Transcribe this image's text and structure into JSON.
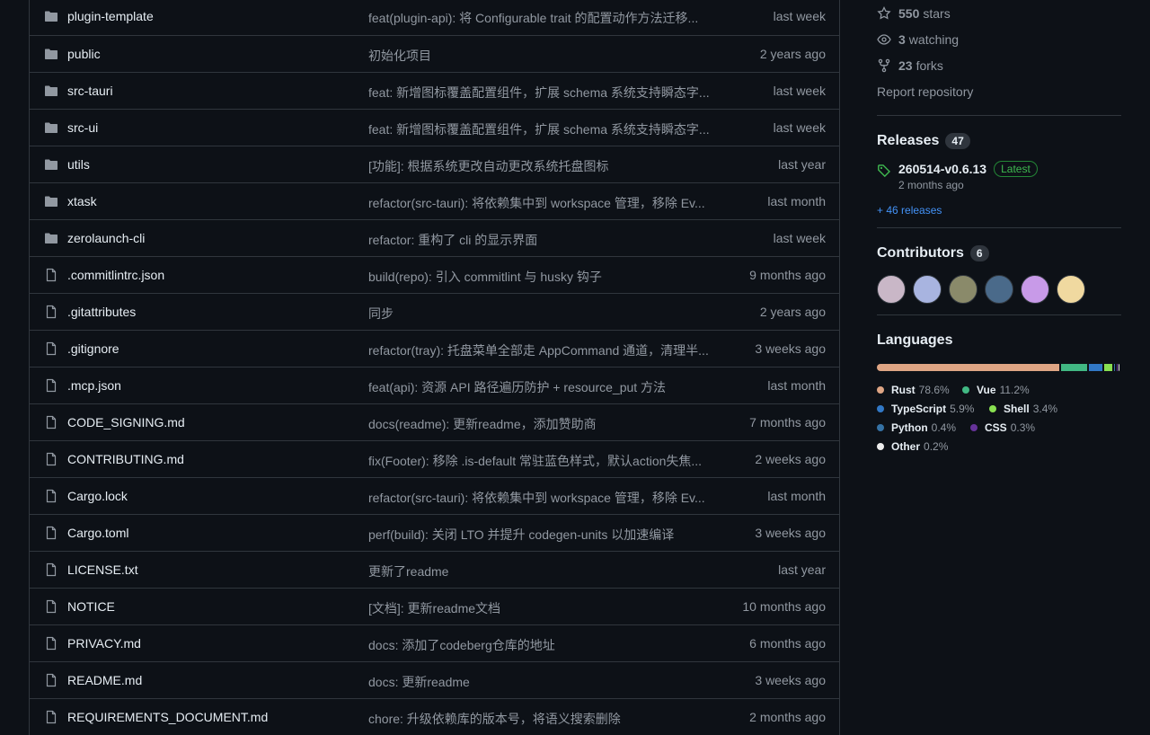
{
  "files": [
    {
      "name": "plugin-template",
      "type": "dir",
      "commit": "feat(plugin-api): 将 Configurable trait 的配置动作方法迁移...",
      "time": "last week"
    },
    {
      "name": "public",
      "type": "dir",
      "commit": "初始化项目",
      "time": "2 years ago"
    },
    {
      "name": "src-tauri",
      "type": "dir",
      "commit": "feat: 新增图标覆盖配置组件，扩展 schema 系统支持瞬态字...",
      "time": "last week"
    },
    {
      "name": "src-ui",
      "type": "dir",
      "commit": "feat: 新增图标覆盖配置组件，扩展 schema 系统支持瞬态字...",
      "time": "last week"
    },
    {
      "name": "utils",
      "type": "dir",
      "commit": "[功能]: 根据系统更改自动更改系统托盘图标",
      "time": "last year"
    },
    {
      "name": "xtask",
      "type": "dir",
      "commit": "refactor(src-tauri): 将依赖集中到 workspace 管理，移除 Ev...",
      "time": "last month"
    },
    {
      "name": "zerolaunch-cli",
      "type": "dir",
      "commit": "refactor: 重构了 cli 的显示界面",
      "time": "last week"
    },
    {
      "name": ".commitlintrc.json",
      "type": "file",
      "commit": "build(repo): 引入 commitlint 与 husky 钩子",
      "time": "9 months ago"
    },
    {
      "name": ".gitattributes",
      "type": "file",
      "commit": "同步",
      "time": "2 years ago"
    },
    {
      "name": ".gitignore",
      "type": "file",
      "commit": "refactor(tray): 托盘菜单全部走 AppCommand 通道，清理半...",
      "time": "3 weeks ago"
    },
    {
      "name": ".mcp.json",
      "type": "file",
      "commit": "feat(api): 资源 API 路径遍历防护 + resource_put 方法",
      "time": "last month"
    },
    {
      "name": "CODE_SIGNING.md",
      "type": "file",
      "commit": "docs(readme): 更新readme，添加赞助商",
      "time": "7 months ago"
    },
    {
      "name": "CONTRIBUTING.md",
      "type": "file",
      "commit": "fix(Footer): 移除 .is-default 常驻蓝色样式，默认action失焦...",
      "time": "2 weeks ago"
    },
    {
      "name": "Cargo.lock",
      "type": "file",
      "commit": "refactor(src-tauri): 将依赖集中到 workspace 管理，移除 Ev...",
      "time": "last month"
    },
    {
      "name": "Cargo.toml",
      "type": "file",
      "commit": "perf(build): 关闭 LTO 并提升 codegen-units 以加速编译",
      "time": "3 weeks ago"
    },
    {
      "name": "LICENSE.txt",
      "type": "file",
      "commit": "更新了readme",
      "time": "last year"
    },
    {
      "name": "NOTICE",
      "type": "file",
      "commit": "[文档]: 更新readme文档",
      "time": "10 months ago"
    },
    {
      "name": "PRIVACY.md",
      "type": "file",
      "commit": "docs: 添加了codeberg仓库的地址",
      "time": "6 months ago"
    },
    {
      "name": "README.md",
      "type": "file",
      "commit": "docs: 更新readme",
      "time": "3 weeks ago"
    },
    {
      "name": "REQUIREMENTS_DOCUMENT.md",
      "type": "file",
      "commit": "chore: 升级依赖库的版本号，将语义搜索删除",
      "time": "2 months ago"
    }
  ],
  "sidebar": {
    "stars_count": "550",
    "stars_label": "stars",
    "watching_count": "3",
    "watching_label": "watching",
    "forks_count": "23",
    "forks_label": "forks",
    "report": "Report repository",
    "releases_title": "Releases",
    "releases_count": "47",
    "release_tag": "260514-v0.6.13",
    "release_badge": "Latest",
    "release_date": "2 months ago",
    "more_releases": "+ 46 releases",
    "contributors_title": "Contributors",
    "contributors_count": "6",
    "languages_title": "Languages"
  },
  "languages": [
    {
      "name": "Rust",
      "pct": "78.6%",
      "value": 78.6,
      "color": "#dea584"
    },
    {
      "name": "Vue",
      "pct": "11.2%",
      "value": 11.2,
      "color": "#41b883"
    },
    {
      "name": "TypeScript",
      "pct": "5.9%",
      "value": 5.9,
      "color": "#3178c6"
    },
    {
      "name": "Shell",
      "pct": "3.4%",
      "value": 3.4,
      "color": "#89e051"
    },
    {
      "name": "Python",
      "pct": "0.4%",
      "value": 0.4,
      "color": "#3572A5"
    },
    {
      "name": "CSS",
      "pct": "0.3%",
      "value": 0.3,
      "color": "#663399"
    },
    {
      "name": "Other",
      "pct": "0.2%",
      "value": 0.2,
      "color": "#ededed"
    }
  ],
  "contributor_colors": [
    "#c9b7c7",
    "#a8b4e0",
    "#8a8a6a",
    "#4a6a8a",
    "#c89ae8",
    "#f0d9a0"
  ]
}
